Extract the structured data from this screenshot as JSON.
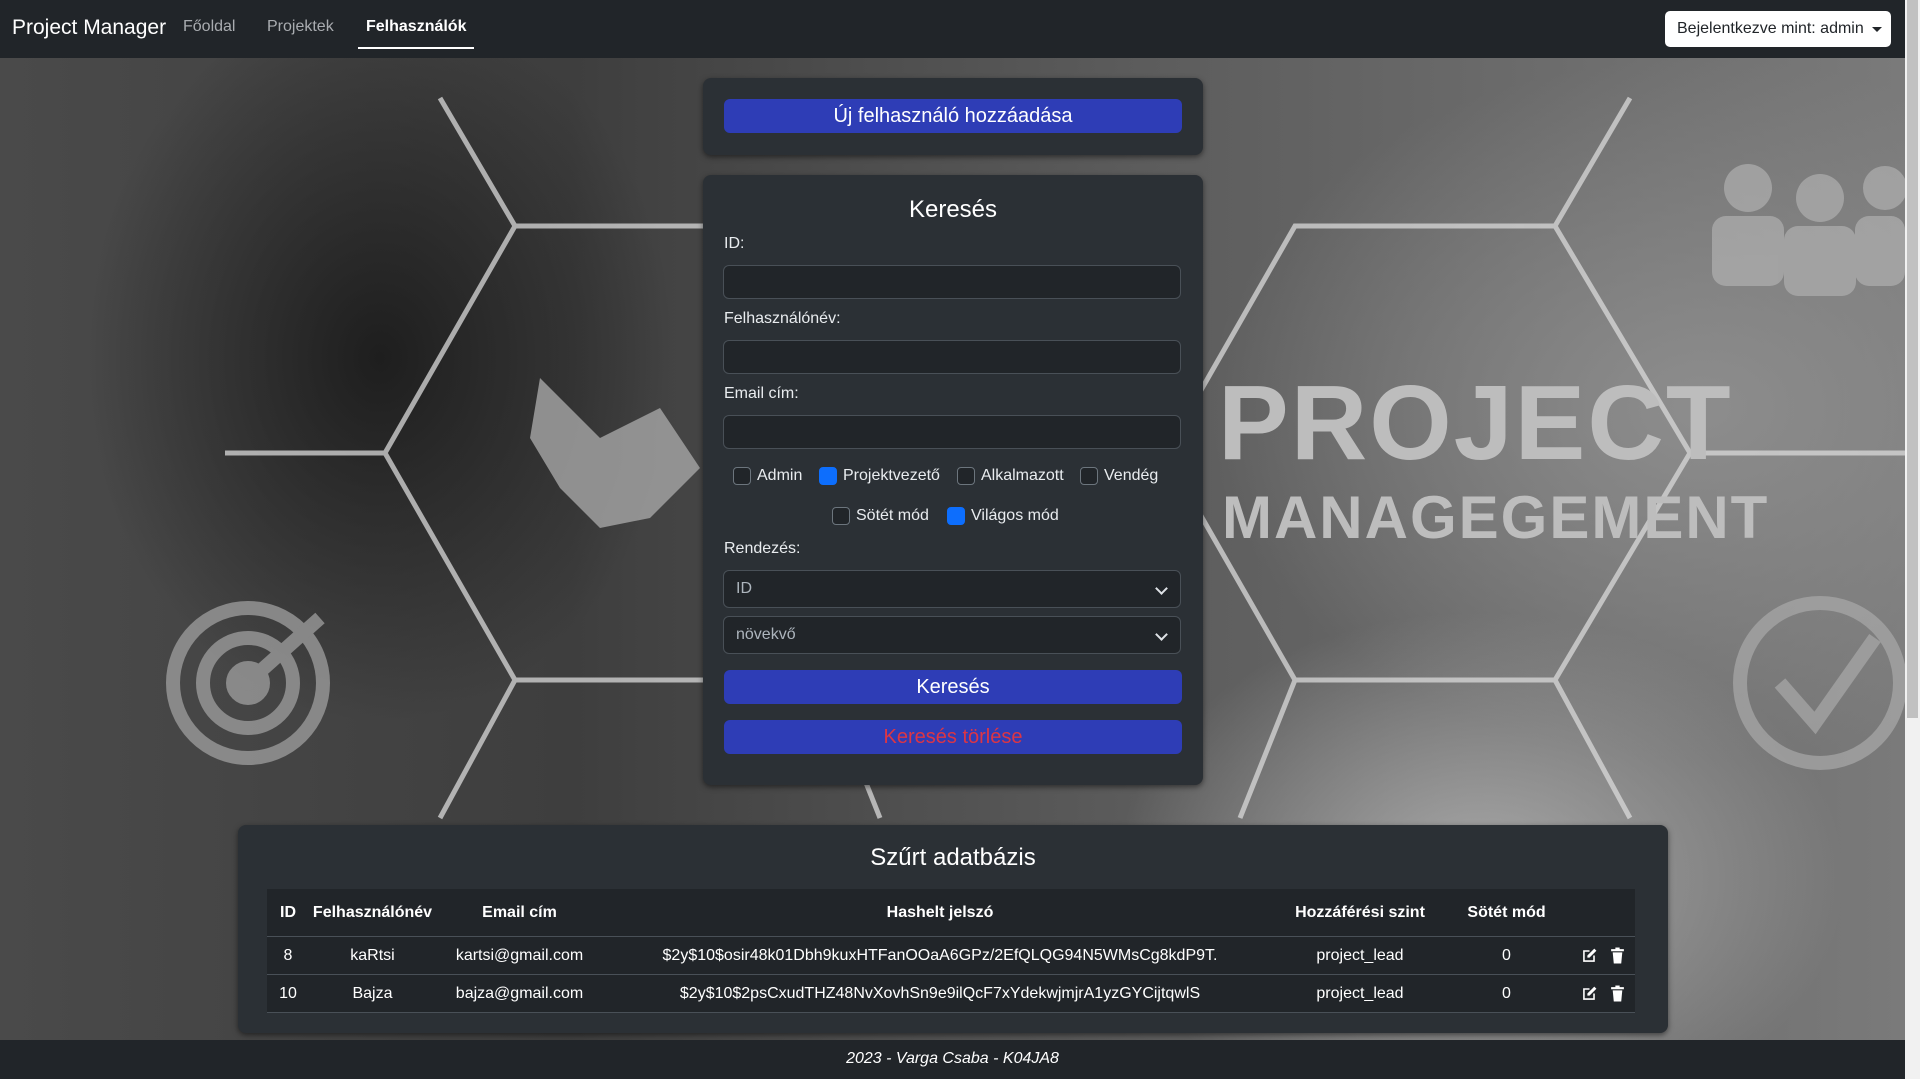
{
  "nav": {
    "brand": "Project Manager",
    "links": [
      "Főoldal",
      "Projektek",
      "Felhasználók"
    ],
    "user_menu": "Bejelentkezve mint: admin"
  },
  "background": {
    "word1": "PROJECT",
    "word2": "MANAGEGEMENT"
  },
  "add_card": {
    "button": "Új felhasználó hozzáadása"
  },
  "search": {
    "title": "Keresés",
    "id_label": "ID:",
    "username_label": "Felhasználónév:",
    "email_label": "Email cím:",
    "roles": [
      {
        "label": "Admin",
        "checked": false
      },
      {
        "label": "Projektvezető",
        "checked": true
      },
      {
        "label": "Alkalmazott",
        "checked": false
      },
      {
        "label": "Vendég",
        "checked": false
      }
    ],
    "modes": [
      {
        "label": "Sötét mód",
        "checked": false
      },
      {
        "label": "Világos mód",
        "checked": true
      }
    ],
    "sort_label": "Rendezés:",
    "sort_field": "ID",
    "sort_order": "növekvő",
    "search_button": "Keresés",
    "clear_button": "Keresés törlése"
  },
  "results": {
    "title": "Szűrt adatbázis",
    "columns": [
      "ID",
      "Felhasználónév",
      "Email cím",
      "Hashelt jelszó",
      "Hozzáférési szint",
      "Sötét mód",
      ""
    ],
    "rows": [
      {
        "id": "8",
        "username": "kaRtsi",
        "email": "kartsi@gmail.com",
        "hash": "$2y$10$osir48k01Dbh9kuxHTFanOOaA6GPz/2EfQLQG94N5WMsCg8kdP9T.",
        "level": "project_lead",
        "dark": "0"
      },
      {
        "id": "10",
        "username": "Bajza",
        "email": "bajza@gmail.com",
        "hash": "$2y$10$2psCxudTHZ48NvXovhSn9e9ilQcF7xYdekwjmjrA1yzGYCijtqwlS",
        "level": "project_lead",
        "dark": "0"
      }
    ]
  },
  "footer": "2023 - Varga Csaba - K04JA8",
  "colors": {
    "accent": "#2e3db6",
    "danger_text": "#dc3545",
    "navbar": "#212529",
    "card": "#2b3035"
  }
}
